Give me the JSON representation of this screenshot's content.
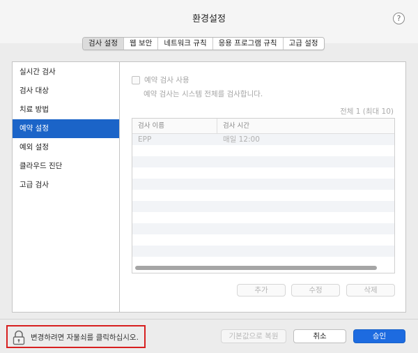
{
  "window": {
    "title": "환경설정"
  },
  "header": {
    "help_icon": "question-icon",
    "help_glyph": "?"
  },
  "tabs": [
    {
      "label": "검사 설정",
      "selected": true
    },
    {
      "label": "웹 보안",
      "selected": false
    },
    {
      "label": "네트워크 규칙",
      "selected": false
    },
    {
      "label": "응용 프로그램 규칙",
      "selected": false
    },
    {
      "label": "고급 설정",
      "selected": false
    }
  ],
  "sidebar": {
    "items": [
      {
        "label": "실시간 검사",
        "active": false
      },
      {
        "label": "검사 대상",
        "active": false
      },
      {
        "label": "치료 방법",
        "active": false
      },
      {
        "label": "예약 설정",
        "active": true
      },
      {
        "label": "예외 설정",
        "active": false
      },
      {
        "label": "클라우드 진단",
        "active": false
      },
      {
        "label": "고급 검사",
        "active": false
      }
    ]
  },
  "schedule": {
    "enable_label": "예약 검사 사용",
    "enabled": false,
    "description": "예약 검사는 시스템 전체를 검사합니다.",
    "count_text": "전체 1 (최대 10)",
    "table": {
      "headers": [
        "검사 이름",
        "검사 시간"
      ],
      "rows": [
        {
          "name": "EPP",
          "time": "매일 12:00"
        }
      ]
    },
    "buttons": {
      "add": "추가",
      "edit": "수정",
      "delete": "삭제"
    }
  },
  "footer": {
    "lock_text": "변경하려면 자물쇠를 클릭하십시오.",
    "lock_icon": "lock-icon",
    "restore_label": "기본값으로 복원",
    "cancel_label": "취소",
    "ok_label": "승인"
  },
  "colors": {
    "accent": "#1d6be0",
    "sidebar_active": "#1b64c8",
    "highlight_border": "#d71f1f"
  }
}
